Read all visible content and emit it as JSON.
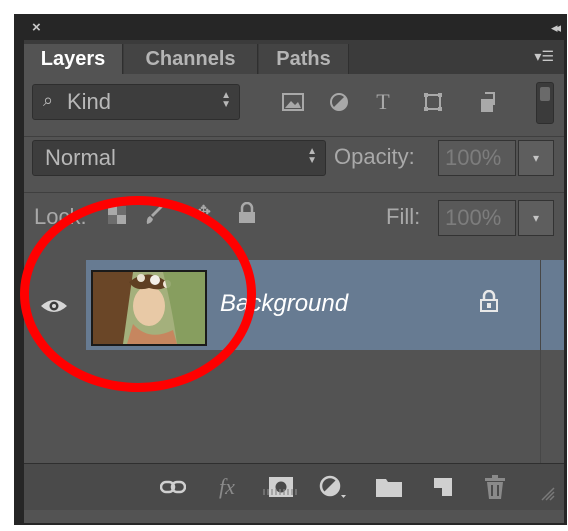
{
  "titlebar": {
    "close_icon": "close-icon",
    "collapse_icon": "collapse-icon"
  },
  "tabs": [
    {
      "label": "Layers",
      "active": true
    },
    {
      "label": "Channels",
      "active": false
    },
    {
      "label": "Paths",
      "active": false
    }
  ],
  "filter": {
    "kind_label": "Kind",
    "icons": [
      "image-filter-icon",
      "adjustment-filter-icon",
      "type-filter-icon",
      "shape-filter-icon",
      "smart-object-filter-icon"
    ]
  },
  "blend": {
    "mode": "Normal",
    "opacity_label": "Opacity:",
    "opacity_value": "100%"
  },
  "lock": {
    "label": "Lock:",
    "fill_label": "Fill:",
    "fill_value": "100%"
  },
  "layers": [
    {
      "name": "Background",
      "visible": true,
      "locked": true,
      "selected": true
    }
  ],
  "bottom_tools": {
    "fx_label": "fx"
  },
  "colors": {
    "panel_bg": "#535353",
    "selected_layer": "#677b92",
    "annotation_circle": "#ff0000"
  }
}
